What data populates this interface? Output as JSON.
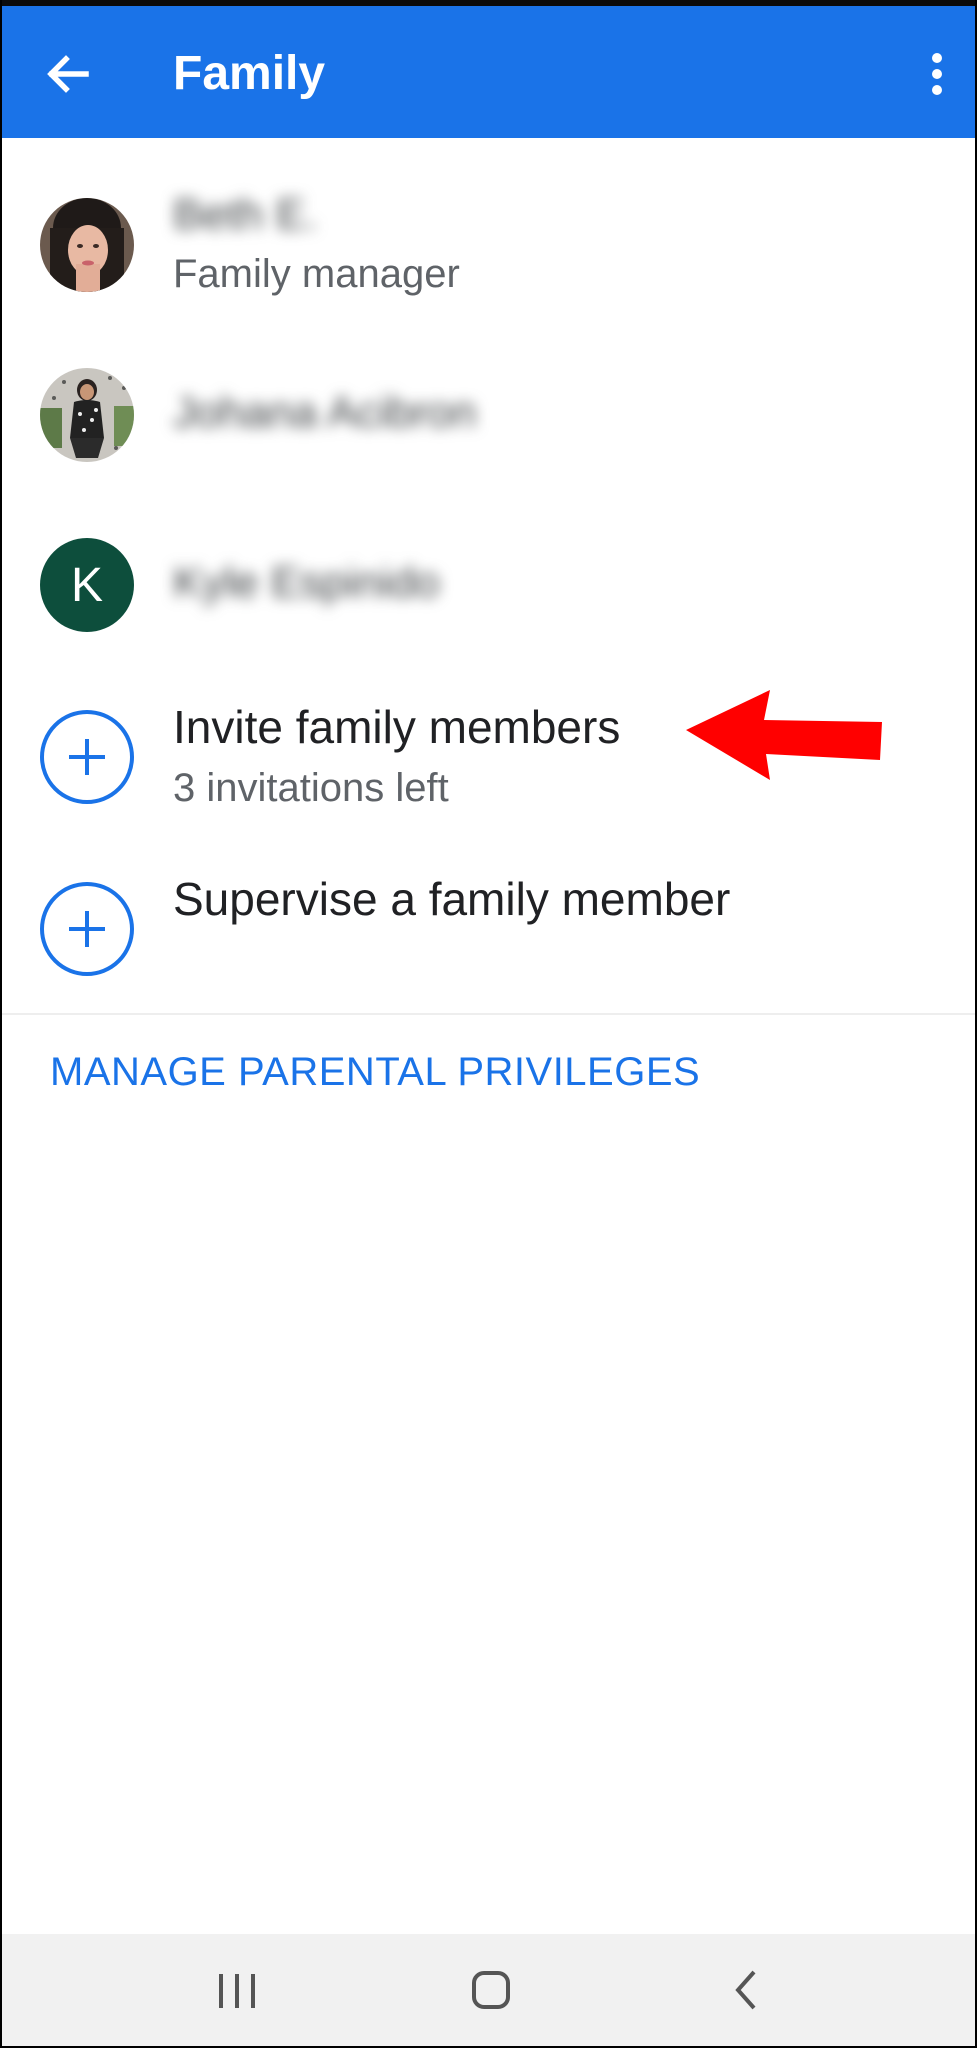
{
  "app_bar": {
    "title": "Family",
    "back_icon": "arrow-back-icon",
    "menu_icon": "more-vert-icon",
    "color": "#1a73e8"
  },
  "members": [
    {
      "name": "Beth E.",
      "role": "Family manager",
      "avatar": "photo"
    },
    {
      "name": "Johana Acibron",
      "role": "",
      "avatar": "photo"
    },
    {
      "name": "Kyle Espinido",
      "role": "",
      "avatar": "letter",
      "initial": "K"
    }
  ],
  "actions": {
    "invite": {
      "label": "Invite family members",
      "sublabel": "3 invitations left",
      "icon": "add-circle-icon"
    },
    "supervise": {
      "label": "Supervise a family member",
      "icon": "add-circle-icon"
    }
  },
  "manage_link": "MANAGE PARENTAL PRIVILEGES",
  "annotation": {
    "icon": "red-arrow-icon",
    "color": "#ff0000"
  },
  "nav_bar": {
    "recents_icon": "recent-apps-icon",
    "home_icon": "home-icon",
    "back_icon": "nav-back-icon"
  }
}
